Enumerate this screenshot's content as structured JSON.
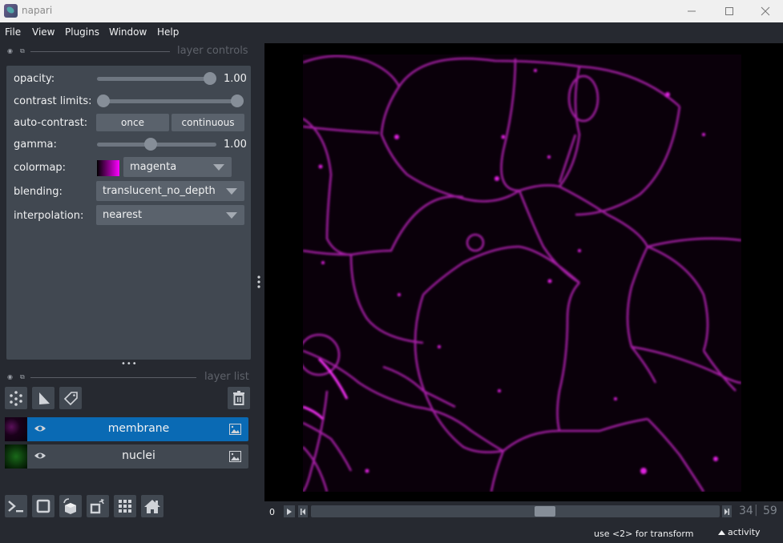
{
  "window": {
    "title": "napari",
    "minimize_icon": "minimize-icon",
    "maximize_icon": "maximize-icon",
    "close_icon": "close-icon"
  },
  "menu": {
    "items": [
      {
        "label": "File"
      },
      {
        "label": "View"
      },
      {
        "label": "Plugins"
      },
      {
        "label": "Window"
      },
      {
        "label": "Help"
      }
    ]
  },
  "layer_controls": {
    "title": "layer controls",
    "opacity": {
      "label": "opacity:",
      "value": "1.00",
      "fraction": 1.0
    },
    "contrast_limits": {
      "label": "contrast limits:",
      "low_fraction": 0.0,
      "high_fraction": 1.0
    },
    "auto_contrast": {
      "label": "auto-contrast:",
      "once": "once",
      "continuous": "continuous"
    },
    "gamma": {
      "label": "gamma:",
      "value": "1.00",
      "fraction": 0.45
    },
    "colormap": {
      "label": "colormap:",
      "value": "magenta",
      "swatch_color": "#ff00ff"
    },
    "blending": {
      "label": "blending:",
      "value": "translucent_no_depth"
    },
    "interpolation": {
      "label": "interpolation:",
      "value": "nearest"
    }
  },
  "layer_list": {
    "title": "layer list",
    "buttons": [
      "new-points-layer",
      "new-shapes-layer",
      "new-labels-layer",
      "delete-layer"
    ],
    "layers": [
      {
        "name": "membrane",
        "selected": true,
        "visible": true,
        "type": "image",
        "thumb_color": "#c020c0"
      },
      {
        "name": "nuclei",
        "selected": false,
        "visible": true,
        "type": "image",
        "thumb_color": "#20c020"
      }
    ]
  },
  "viewer_buttons": [
    "console",
    "ndisplay-2d",
    "roll-dims",
    "transpose-dims",
    "grid-view",
    "home"
  ],
  "dims": {
    "axis_label": "0",
    "current": "34",
    "separator": "|",
    "total": "59",
    "fraction": 0.576
  },
  "status": {
    "hint": "use <2> for transform",
    "activity": "activity"
  },
  "colors": {
    "background": "#262930",
    "panel": "#414851",
    "control": "#5a626c",
    "selected": "#0a6ab4",
    "text": "#f0f1f2",
    "membrane": "#ff00ff"
  }
}
